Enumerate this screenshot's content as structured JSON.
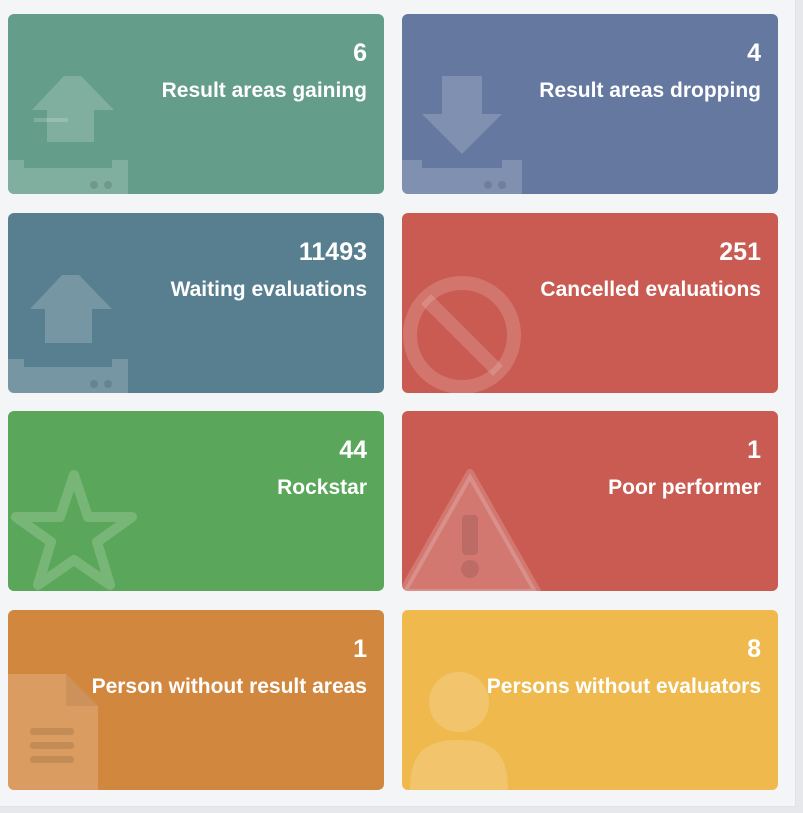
{
  "tiles": [
    {
      "value": "6",
      "label": "Result areas gaining",
      "color": "#649e8b",
      "icon": "upload-tray-icon"
    },
    {
      "value": "4",
      "label": "Result areas dropping",
      "color": "#6578a0",
      "icon": "download-tray-icon"
    },
    {
      "value": "11493",
      "label": "Waiting evaluations",
      "color": "#587f8f",
      "icon": "upload-tray-icon"
    },
    {
      "value": "251",
      "label": "Cancelled evaluations",
      "color": "#c95b52",
      "icon": "ban-icon"
    },
    {
      "value": "44",
      "label": "Rockstar",
      "color": "#5aa65a",
      "icon": "star-icon"
    },
    {
      "value": "1",
      "label": "Poor performer",
      "color": "#c95b52",
      "icon": "warning-icon"
    },
    {
      "value": "1",
      "label": "Person without result areas",
      "color": "#d2873f",
      "icon": "document-icon"
    },
    {
      "value": "8",
      "label": "Persons without evaluators",
      "color": "#efb94d",
      "icon": "user-icon"
    }
  ]
}
